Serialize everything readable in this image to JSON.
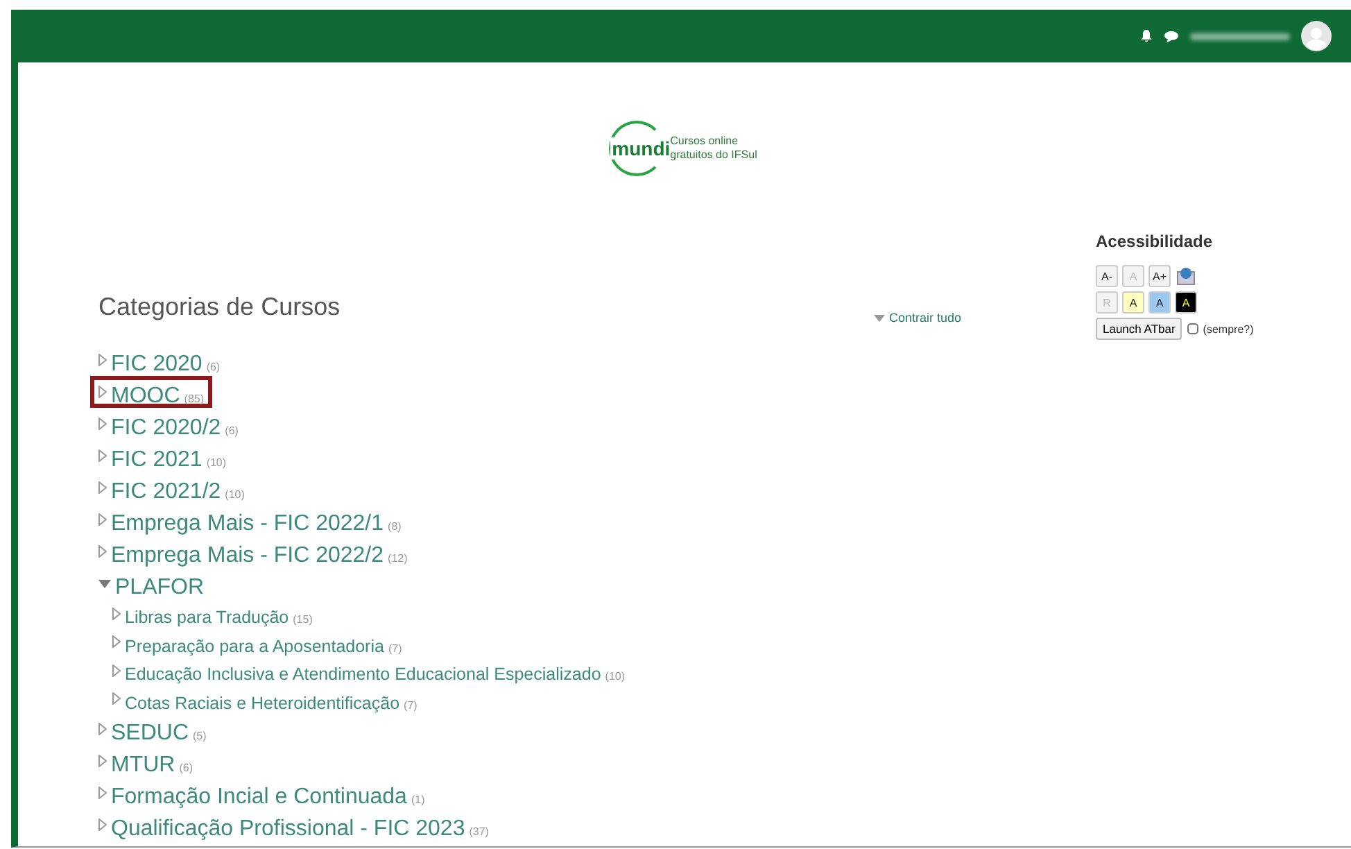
{
  "logo": {
    "wordmark": "mundi",
    "tagline_lines": [
      "Cursos online",
      "gratuitos do IFSul"
    ]
  },
  "heading": "Categorias de Cursos",
  "collapse_link": "Contrair tudo",
  "categories": [
    {
      "name": "FIC 2020",
      "count": "(6)",
      "expanded": false,
      "highlighted": false
    },
    {
      "name": "MOOC",
      "count": "(85)",
      "expanded": false,
      "highlighted": true
    },
    {
      "name": "FIC 2020/2",
      "count": "(6)",
      "expanded": false,
      "highlighted": false
    },
    {
      "name": "FIC 2021",
      "count": "(10)",
      "expanded": false,
      "highlighted": false
    },
    {
      "name": "FIC 2021/2",
      "count": "(10)",
      "expanded": false,
      "highlighted": false
    },
    {
      "name": "Emprega Mais - FIC 2022/1",
      "count": "(8)",
      "expanded": false,
      "highlighted": false
    },
    {
      "name": "Emprega Mais - FIC 2022/2",
      "count": "(12)",
      "expanded": false,
      "highlighted": false
    },
    {
      "name": "PLAFOR",
      "expanded": true,
      "highlighted": false,
      "children": [
        {
          "name": "Libras para Tradução",
          "count": "(15)",
          "expanded": false,
          "highlighted": false
        },
        {
          "name": "Preparação para a Aposentadoria",
          "count": "(7)",
          "expanded": false,
          "highlighted": false
        },
        {
          "name": "Educação Inclusiva e Atendimento Educacional Especializado",
          "count": "(10)",
          "expanded": false,
          "highlighted": false
        },
        {
          "name": "Cotas Raciais e Heteroidentificação",
          "count": "(7)",
          "expanded": false,
          "highlighted": false
        }
      ]
    },
    {
      "name": "SEDUC",
      "count": "(5)",
      "expanded": false,
      "highlighted": false
    },
    {
      "name": "MTUR",
      "count": "(6)",
      "expanded": false,
      "highlighted": false
    },
    {
      "name": "Formação Incial e Continuada",
      "count": "(1)",
      "expanded": false,
      "highlighted": false
    },
    {
      "name": "Qualificação Profissional - FIC 2023",
      "count": "(37)",
      "expanded": false,
      "highlighted": false
    }
  ],
  "accessibility": {
    "title": "Acessibilidade",
    "rows": [
      [
        {
          "label": "A-",
          "kind": "plain",
          "disabled": false
        },
        {
          "label": "A",
          "kind": "plain",
          "disabled": true
        },
        {
          "label": "A+",
          "kind": "plain",
          "disabled": false
        },
        {
          "kind": "icon",
          "disabled": false
        }
      ],
      [
        {
          "label": "R",
          "kind": "plain",
          "disabled": true
        },
        {
          "label": "A",
          "kind": "yellow",
          "disabled": false
        },
        {
          "label": "A",
          "kind": "blue",
          "disabled": false
        },
        {
          "label": "A",
          "kind": "black",
          "disabled": false
        }
      ]
    ],
    "launch_button": "Launch ATbar",
    "always_label": "(sempre?)",
    "always_checked": false
  }
}
